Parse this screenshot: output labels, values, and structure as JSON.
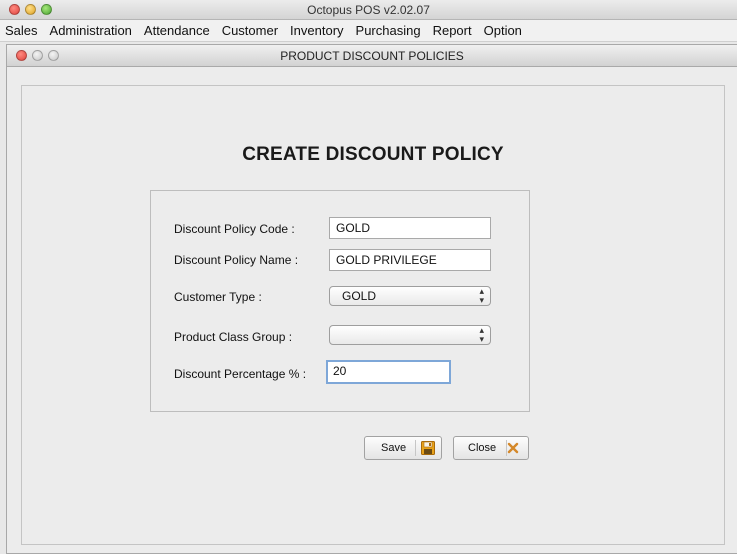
{
  "app": {
    "title": "Octopus POS v2.02.07"
  },
  "menu": {
    "items": [
      "Sales",
      "Administration",
      "Attendance",
      "Customer",
      "Inventory",
      "Purchasing",
      "Report",
      "Option"
    ]
  },
  "dialog": {
    "title": "PRODUCT DISCOUNT POLICIES",
    "heading": "CREATE DISCOUNT POLICY",
    "fields": {
      "policy_code": {
        "label": "Discount Policy Code :",
        "value": "GOLD"
      },
      "policy_name": {
        "label": "Discount Policy Name :",
        "value": "GOLD PRIVILEGE"
      },
      "customer_type": {
        "label": "Customer Type :",
        "value": "GOLD"
      },
      "product_class_group": {
        "label": "Product Class Group :",
        "value": ""
      },
      "discount_percentage": {
        "label": "Discount Percentage % :",
        "value": "20"
      }
    },
    "buttons": {
      "save": {
        "label": "Save",
        "icon": "floppy-disk-icon"
      },
      "close": {
        "label": "Close",
        "icon": "x-icon"
      }
    }
  },
  "colors": {
    "close_dot": "#e0443e",
    "minimize_dot": "#dea123",
    "zoom_dot": "#4aa433",
    "focus_border": "#7ea7d8",
    "save_icon": "#e8a21a",
    "close_icon": "#d4882a"
  }
}
